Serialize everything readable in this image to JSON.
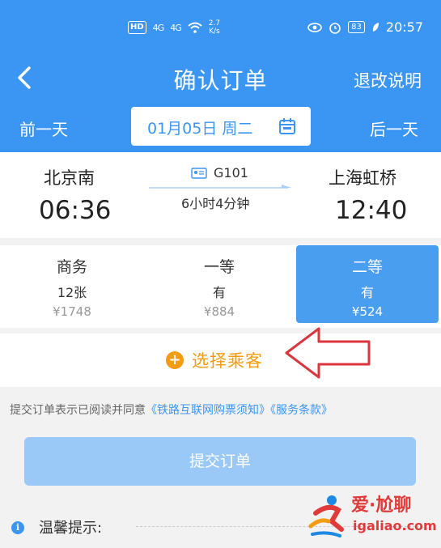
{
  "status_bar": {
    "hd": "HD",
    "signal_1": "4G",
    "signal_2": "4G",
    "speed": "2.7\nK/s",
    "battery": "83",
    "time": "20:57"
  },
  "navbar": {
    "title": "确认订单",
    "refund_label": "退改说明"
  },
  "datebar": {
    "prev_label": "前一天",
    "date_text": "01月05日 周二",
    "next_label": "后一天"
  },
  "train": {
    "from_station": "北京南",
    "from_time": "06:36",
    "train_no": "G101",
    "duration": "6小时4分钟",
    "to_station": "上海虹桥",
    "to_time": "12:40"
  },
  "seats": [
    {
      "name": "商务",
      "count": "12张",
      "price": "¥1748",
      "selected": false
    },
    {
      "name": "一等",
      "count": "有",
      "price": "¥884",
      "selected": false
    },
    {
      "name": "二等",
      "count": "有",
      "price": "¥524",
      "selected": true
    }
  ],
  "passenger": {
    "label": "选择乘客"
  },
  "agreement": {
    "prefix": "提交订单表示已阅读并同意",
    "link1": "《铁路互联网购票须知》",
    "link2": "《服务条款》"
  },
  "submit_label": "提交订单",
  "tip_label": "温馨提示:",
  "watermark": {
    "brand": "爱·尬聊",
    "site": "igaliao.com"
  },
  "colors": {
    "primary": "#3b95f2",
    "accent": "#f39c12",
    "selected_seat": "#4a9ef0",
    "submit_disabled": "#9ac9f7"
  }
}
